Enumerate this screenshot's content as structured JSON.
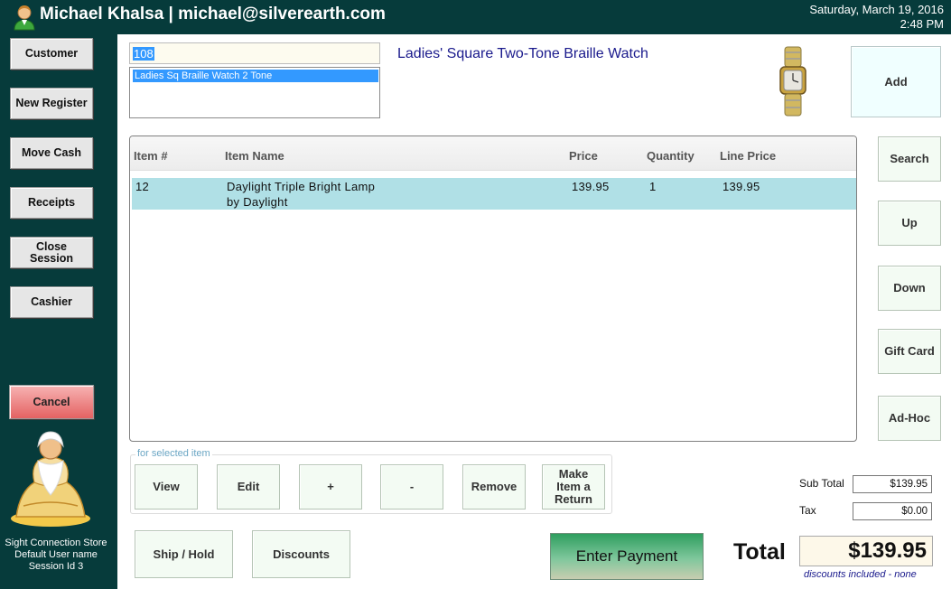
{
  "header": {
    "user": "Michael Khalsa | michael@silverearth.com",
    "date": "Saturday, March 19, 2016",
    "time": "2:48 PM"
  },
  "sidebar": {
    "buttons": [
      "Customer",
      "New Register",
      "Move Cash",
      "Receipts",
      "Close Session",
      "Cashier"
    ],
    "cancel": "Cancel",
    "store": "Sight Connection Store",
    "user_name": "Default User name",
    "session": "Session Id 3"
  },
  "search": {
    "value": "108",
    "suggestion": "Ladies Sq Braille Watch 2 Tone"
  },
  "product": {
    "title": "Ladies' Square Two-Tone Braille Watch"
  },
  "right_buttons": {
    "add": "Add",
    "search": "Search",
    "up": "Up",
    "down": "Down",
    "gift_card": "Gift Card",
    "ad_hoc": "Ad-Hoc"
  },
  "table": {
    "columns": [
      "Item #",
      "Item Name",
      "Price",
      "Quantity",
      "Line Price"
    ],
    "rows": [
      {
        "item_no": "12",
        "name_line1": "Daylight Triple Bright Lamp",
        "name_line2": "by Daylight",
        "price": "139.95",
        "quantity": "1",
        "line_price": "139.95"
      }
    ]
  },
  "selected_item": {
    "label": "for selected item",
    "view": "View",
    "edit": "Edit",
    "plus": "+",
    "minus": "-",
    "remove": "Remove",
    "return": "Make Item a Return"
  },
  "bottom": {
    "ship_hold": "Ship / Hold",
    "discounts": "Discounts",
    "enter_payment": "Enter Payment"
  },
  "totals": {
    "subtotal_label": "Sub Total",
    "subtotal": "$139.95",
    "tax_label": "Tax",
    "tax": "$0.00",
    "total_label": "Total",
    "total": "$139.95",
    "discount_note": "discounts included - none"
  },
  "icons": {
    "user": "user-avatar-icon",
    "product": "wristwatch-image",
    "logo": "meditating-sage-logo"
  },
  "colors": {
    "sidebar": "#063b3b",
    "selected_row": "#b0e0e6",
    "accent_text": "#1a1a8c"
  }
}
